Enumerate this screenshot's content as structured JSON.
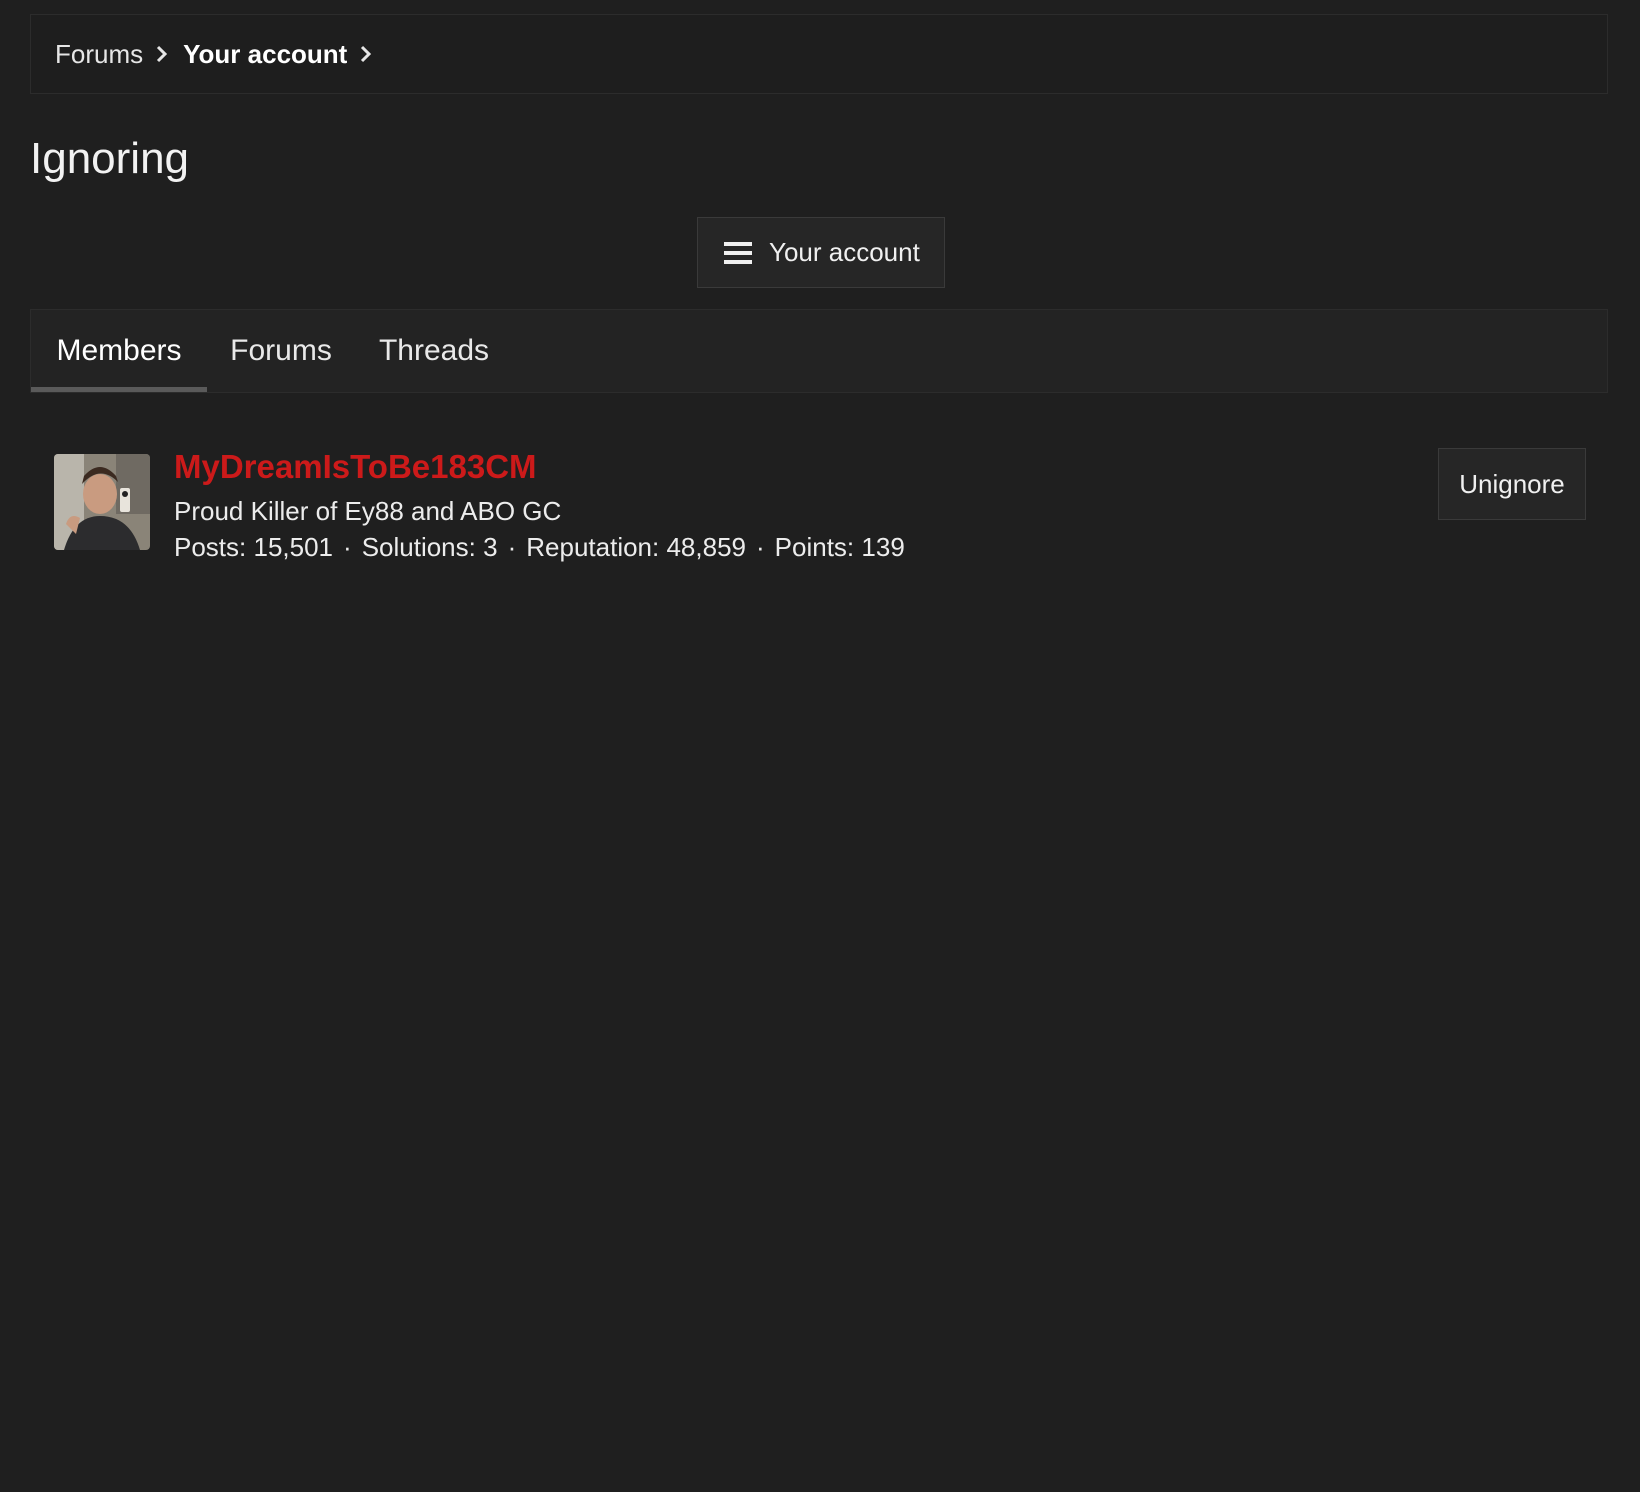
{
  "breadcrumb": {
    "items": [
      {
        "label": "Forums"
      },
      {
        "label": "Your account"
      }
    ]
  },
  "page": {
    "title": "Ignoring"
  },
  "account_menu": {
    "icon": "hamburger-menu-icon",
    "label": "Your account"
  },
  "tabs": [
    {
      "label": "Members",
      "active": true
    },
    {
      "label": "Forums",
      "active": false
    },
    {
      "label": "Threads",
      "active": false
    }
  ],
  "members": [
    {
      "username": "MyDreamIsToBe183CM",
      "username_color": "#cc1a1a",
      "user_title": "Proud Killer of Ey88 and ABO GC",
      "stats": [
        {
          "label": "Posts:",
          "value": "15,501"
        },
        {
          "label": "Solutions:",
          "value": "3"
        },
        {
          "label": "Reputation:",
          "value": "48,859"
        },
        {
          "label": "Points:",
          "value": "139"
        }
      ],
      "stat_separator": "·",
      "action_label": "Unignore"
    }
  ],
  "colors": {
    "background": "#1f1f1f",
    "panel": "#232323",
    "border": "#2c2c2c",
    "accent_red": "#cc1a1a"
  }
}
